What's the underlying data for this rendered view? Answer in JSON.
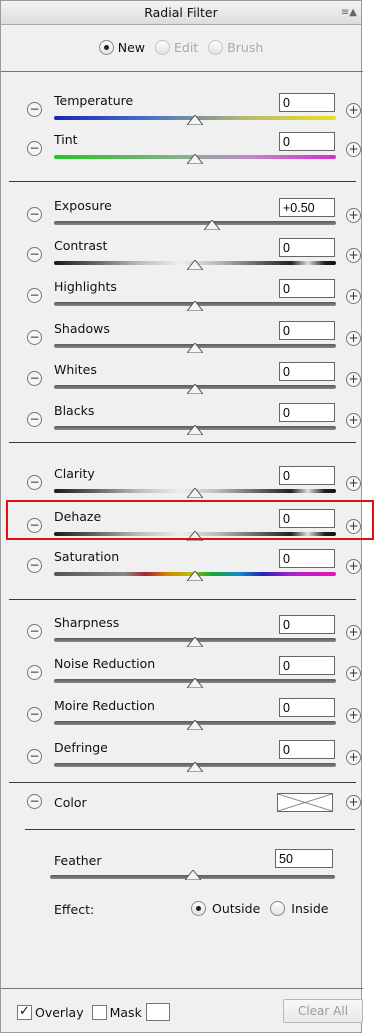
{
  "panel": {
    "title": "Radial Filter",
    "menu_icon": "panel-menu-icon"
  },
  "mode": {
    "options": [
      {
        "label": "New",
        "selected": true,
        "enabled": true
      },
      {
        "label": "Edit",
        "selected": false,
        "enabled": false
      },
      {
        "label": "Brush",
        "selected": false,
        "enabled": false
      }
    ]
  },
  "groups": {
    "white_balance": [
      {
        "label": "Temperature",
        "value": "0",
        "position": 0.5
      },
      {
        "label": "Tint",
        "value": "0",
        "position": 0.5
      }
    ],
    "tone": [
      {
        "label": "Exposure",
        "value": "+0.50",
        "position": 0.56
      },
      {
        "label": "Contrast",
        "value": "0",
        "position": 0.5
      },
      {
        "label": "Highlights",
        "value": "0",
        "position": 0.5
      },
      {
        "label": "Shadows",
        "value": "0",
        "position": 0.5
      },
      {
        "label": "Whites",
        "value": "0",
        "position": 0.5
      },
      {
        "label": "Blacks",
        "value": "0",
        "position": 0.5
      }
    ],
    "presence": [
      {
        "label": "Clarity",
        "value": "0",
        "position": 0.5
      },
      {
        "label": "Dehaze",
        "value": "0",
        "position": 0.5
      },
      {
        "label": "Saturation",
        "value": "0",
        "position": 0.5
      }
    ],
    "detail": [
      {
        "label": "Sharpness",
        "value": "0",
        "position": 0.5
      },
      {
        "label": "Noise Reduction",
        "value": "0",
        "position": 0.5
      },
      {
        "label": "Moire Reduction",
        "value": "0",
        "position": 0.5
      },
      {
        "label": "Defringe",
        "value": "0",
        "position": 0.5
      }
    ]
  },
  "color": {
    "label": "Color"
  },
  "feather": {
    "label": "Feather",
    "value": "50",
    "position": 0.5
  },
  "effect": {
    "label": "Effect:",
    "options": [
      {
        "label": "Outside",
        "selected": true
      },
      {
        "label": "Inside",
        "selected": false
      }
    ]
  },
  "bottom": {
    "overlay_label": "Overlay",
    "overlay_checked": true,
    "mask_label": "Mask",
    "mask_checked": false,
    "clear_all_label": "Clear All"
  },
  "colors": {
    "highlight_border": "#e01010",
    "panel_bg": "#f0f0f0"
  }
}
